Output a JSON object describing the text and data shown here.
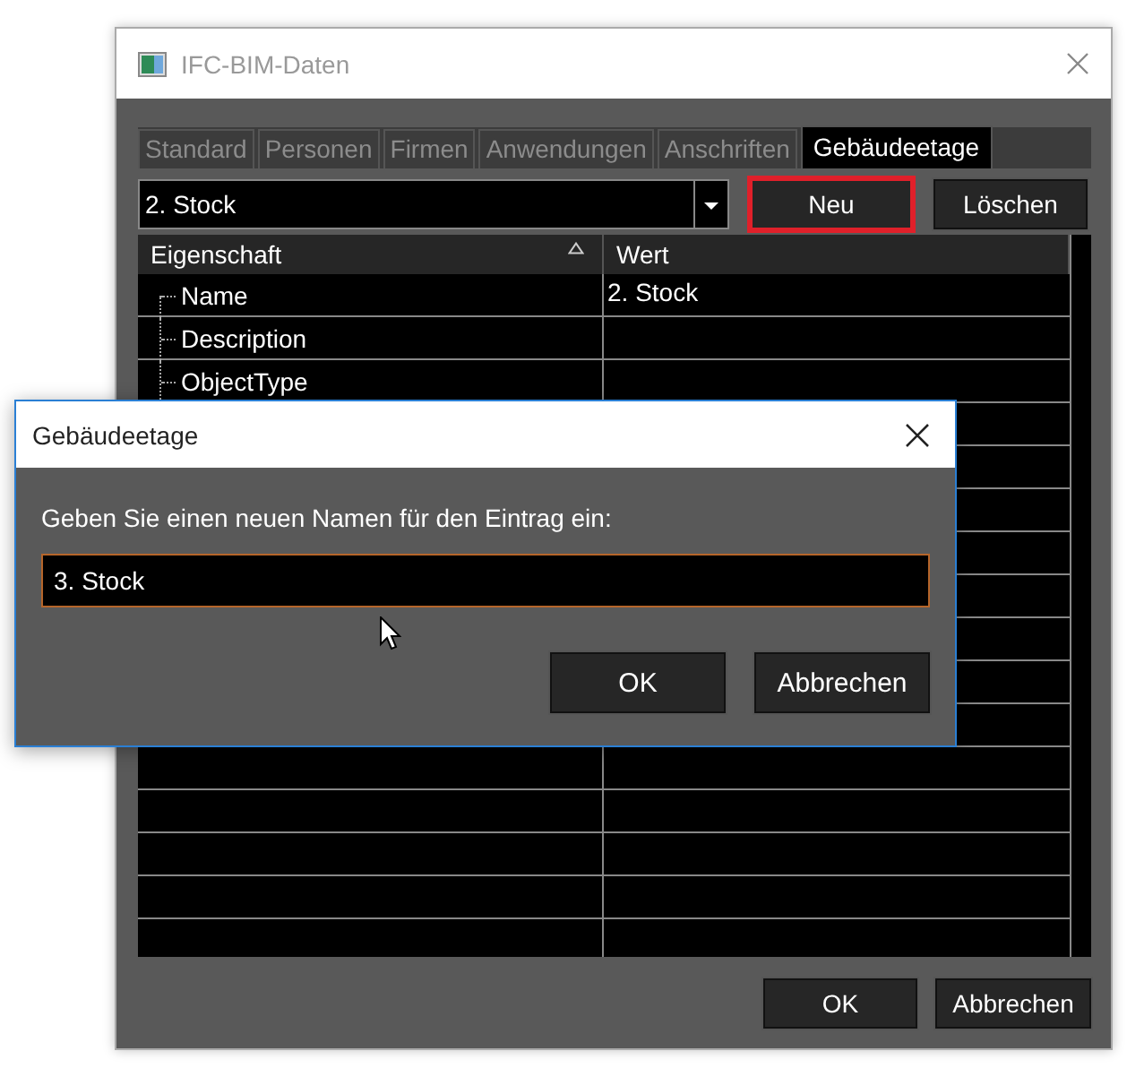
{
  "window": {
    "title": "IFC-BIM-Daten"
  },
  "tabs": [
    {
      "label": "Standard",
      "selected": false
    },
    {
      "label": "Personen",
      "selected": false
    },
    {
      "label": "Firmen",
      "selected": false
    },
    {
      "label": "Anwendungen",
      "selected": false
    },
    {
      "label": "Anschriften",
      "selected": false
    },
    {
      "label": "Gebäudeetage",
      "selected": true
    }
  ],
  "storey_select": {
    "value": "2. Stock"
  },
  "toolbar_buttons": [
    {
      "label": "Neu",
      "highlighted": true
    },
    {
      "label": "Löschen",
      "highlighted": false
    }
  ],
  "table": {
    "columns": [
      {
        "label": "Eigenschaft",
        "sorted": true
      },
      {
        "label": "Wert",
        "sorted": false
      }
    ],
    "rows": [
      {
        "property": "Name",
        "value": "2. Stock"
      },
      {
        "property": "Description"
      },
      {
        "property": "ObjectType"
      }
    ]
  },
  "buttons": [
    "OK",
    "Abbrechen"
  ],
  "dialog": {
    "title": "Gebäudeetage",
    "prompt": "Geben Sie einen neuen Namen für den Eintrag ein:",
    "input": {
      "value": "3. Stock"
    },
    "buttons": [
      "OK",
      "Abbrechen"
    ]
  }
}
